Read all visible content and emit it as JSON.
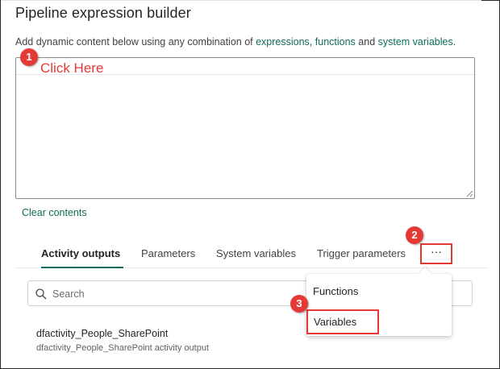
{
  "dialog": {
    "title": "Pipeline expression builder",
    "description_prefix": "Add dynamic content below using any combination of ",
    "link_expressions": "expressions,",
    "link_functions": "functions",
    "and_text": " and ",
    "link_system_variables": "system variables",
    "period": "."
  },
  "editor": {
    "value": ""
  },
  "clear_contents": "Clear contents",
  "tabs": [
    {
      "label": "Activity outputs",
      "active": true
    },
    {
      "label": "Parameters",
      "active": false
    },
    {
      "label": "System variables",
      "active": false
    },
    {
      "label": "Trigger parameters",
      "active": false
    }
  ],
  "more_button": {
    "label": "···"
  },
  "search": {
    "placeholder": "Search"
  },
  "menu": {
    "items": [
      {
        "label": "Functions"
      },
      {
        "label": "Variables"
      }
    ]
  },
  "activities": [
    {
      "name": "dfactivity_People_SharePoint",
      "description": "dfactivity_People_SharePoint activity output"
    }
  ],
  "annotations": {
    "badges": [
      "1",
      "2",
      "3"
    ],
    "callout": "Click Here",
    "highlight_color": "#e53935"
  },
  "colors": {
    "accent": "#0f6c5a",
    "annotation": "#e53935"
  }
}
